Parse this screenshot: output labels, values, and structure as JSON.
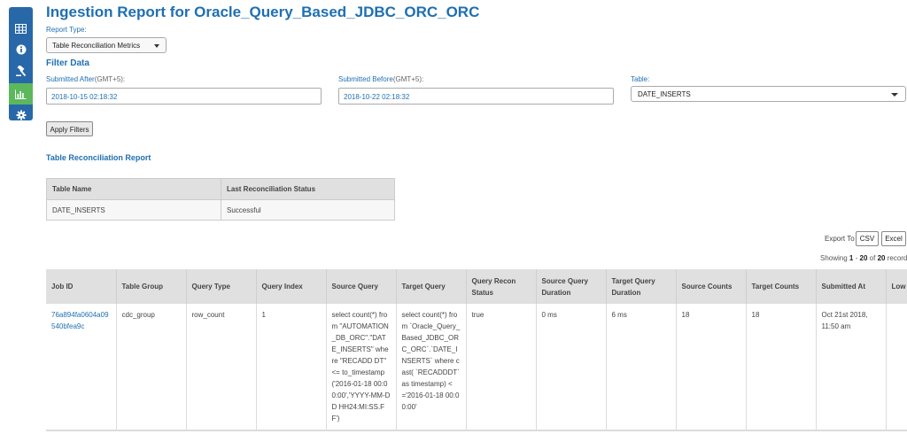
{
  "sidebar": {
    "items": [
      {
        "icon": "table-icon"
      },
      {
        "icon": "info-icon"
      },
      {
        "icon": "gavel-icon"
      },
      {
        "icon": "bar-chart-icon"
      },
      {
        "icon": "gear-icon"
      }
    ],
    "active_index": 3,
    "color": "#2868a8",
    "active_color": "#5cb85c"
  },
  "header": {
    "title": "Ingestion Report for Oracle_Query_Based_JDBC_ORC_ORC"
  },
  "report_type": {
    "label": "Report Type:",
    "selected": "Table Reconciliation Metrics"
  },
  "filter": {
    "heading": "Filter Data",
    "submitted_after": {
      "label": "Submitted After",
      "tz": "(GMT+5):",
      "value": "2018-10-15 02:18:32"
    },
    "submitted_before": {
      "label": "Submitted Before",
      "tz": "(GMT+5):",
      "value": "2018-10-22 02:18:32"
    },
    "table": {
      "label": "Table:",
      "selected": "DATE_INSERTS"
    },
    "apply_label": "Apply Filters"
  },
  "recon": {
    "heading": "Table Reconciliation Report",
    "headers": [
      "Table Name",
      "Last Reconciliation Status"
    ],
    "rows": [
      [
        "DATE_INSERTS",
        "Successful"
      ]
    ]
  },
  "export": {
    "label": "Export To",
    "csv": "CSV",
    "excel": "Excel"
  },
  "records": {
    "prefix": "Showing",
    "start": "1",
    "sep": "-",
    "end": "20",
    "of": "of",
    "total": "20",
    "suffix": "records."
  },
  "main_table": {
    "headers": [
      "Job ID",
      "Table Group",
      "Query Type",
      "Query Index",
      "Source Query",
      "Target Query",
      "Query Recon Status",
      "Source Query Duration",
      "Target Query Duration",
      "Source Counts",
      "Target Counts",
      "Submitted At",
      "Low"
    ],
    "rows": [
      {
        "job_id": "76a894fa0604a09540bfea9c",
        "table_group": "cdc_group",
        "query_type": "row_count",
        "query_index": "1",
        "source_query": "select count(*) from \"AUTOMATION_DB_ORC\".\"DATE_INSERTS\" where \"RECADD DT\" <= to_timestamp('2016-01-18 00:00:00','YYYY-MM-DD HH24:MI:SS.FF')",
        "target_query": "select count(*) from `Oracle_Query_Based_JDBC_ORC_ORC`.`DATE_INSERTS` where cast( `RECADDDT` as timestamp) <='2016-01-18 00:00:00'",
        "recon_status": "true",
        "source_duration": "0 ms",
        "target_duration": "6 ms",
        "source_counts": "18",
        "target_counts": "18",
        "submitted_at": "Oct 21st 2018, 11:50 am",
        "low": ""
      }
    ]
  },
  "colors": {
    "accent": "#1f6fb2",
    "header_bg": "#e0e0e0"
  }
}
